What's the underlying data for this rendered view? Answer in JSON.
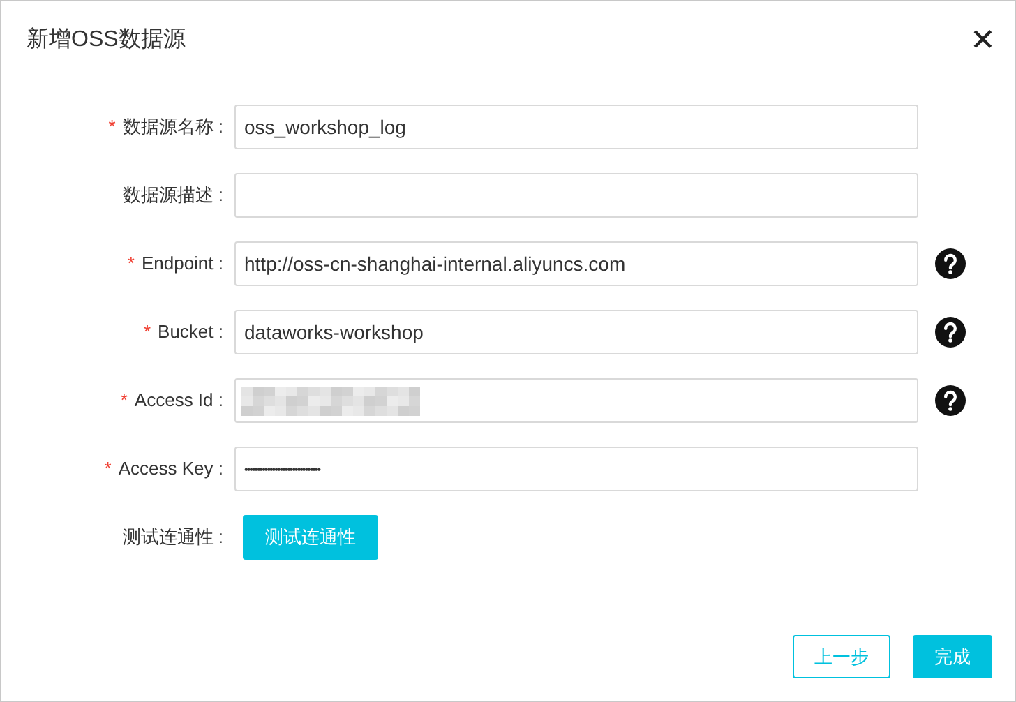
{
  "dialog": {
    "title": "新增OSS数据源",
    "close": "✕"
  },
  "fields": [
    {
      "kind": "text",
      "marker": "*",
      "label": "数据源名称 :",
      "value": "oss_workshop_log",
      "help": false
    },
    {
      "kind": "text",
      "label": "数据源描述 :",
      "help": false
    },
    {
      "kind": "text",
      "marker": "*",
      "label": "Endpoint :",
      "value": "http://oss-cn-shanghai-internal.aliyuncs.com",
      "help": true
    },
    {
      "kind": "text",
      "marker": "*",
      "label": "Bucket :",
      "value": "dataworks-workshop",
      "help": true
    },
    {
      "kind": "blurred",
      "marker": "*",
      "label": "Access Id :",
      "help": true
    },
    {
      "kind": "password",
      "marker": "*",
      "label": "Access Key :",
      "value": "••••••••••••••••••••••••••••••",
      "help": false
    }
  ],
  "test": {
    "label": "测试连通性 :",
    "button": "测试连通性"
  },
  "footer": {
    "back": "上一步",
    "finish": "完成"
  }
}
